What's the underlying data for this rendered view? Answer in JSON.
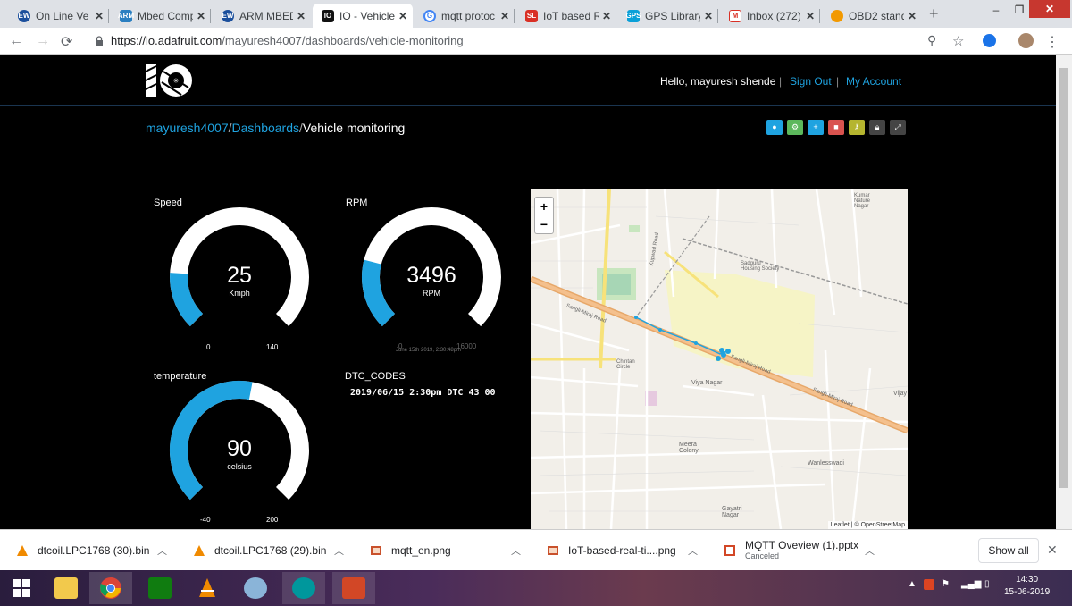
{
  "browser": {
    "tabs": [
      {
        "label": "On Line Ve",
        "fav_color": "#1b4f9c",
        "fav_text": "EW"
      },
      {
        "label": "Mbed Comp",
        "fav_color": "#2a7fc1",
        "fav_text": "ARM"
      },
      {
        "label": "ARM MBED",
        "fav_color": "#1b4f9c",
        "fav_text": "EW"
      },
      {
        "label": "IO - Vehicle",
        "fav_color": "#111111",
        "fav_text": "IO"
      },
      {
        "label": "mqtt protoc",
        "fav_color": "#4285f4",
        "fav_text": "G"
      },
      {
        "label": "IoT based R",
        "fav_color": "#d93025",
        "fav_text": "SL"
      },
      {
        "label": "GPS Library",
        "fav_color": "#0aa0d8",
        "fav_text": "GPS"
      },
      {
        "label": "Inbox (272)",
        "fav_color": "#d93025",
        "fav_text": "M"
      },
      {
        "label": "OBD2 stand",
        "fav_color": "#f29900",
        "fav_text": ""
      }
    ],
    "url_host": "https://io.adafruit.com",
    "url_path": "/mayuresh4007/dashboards/vehicle-monitoring"
  },
  "header": {
    "hello": "Hello, mayuresh shende",
    "sign_out": "Sign Out",
    "my_account": "My Account",
    "sep": "|"
  },
  "breadcrumb": {
    "user": "mayuresh4007",
    "dashboards": "Dashboards",
    "current": "Vehicle monitoring",
    "slash": "/"
  },
  "gauges": {
    "speed": {
      "title": "Speed",
      "value": "25",
      "unit": "Kmph",
      "min": "0",
      "max": "140",
      "fraction": 0.18
    },
    "rpm": {
      "title": "RPM",
      "value": "3496",
      "unit": "RPM",
      "min": "0",
      "max": "16000",
      "fraction": 0.22,
      "timestamp": "June 15th 2019, 2:30:48pm"
    },
    "temperature": {
      "title": "temperature",
      "value": "90",
      "unit": "celsius",
      "min": "-40",
      "max": "200",
      "fraction": 0.54
    }
  },
  "dtc": {
    "title": "DTC_CODES",
    "value": "2019/06/15 2:30pm DTC 43 00"
  },
  "map": {
    "zoom_in": "+",
    "zoom_out": "−",
    "attribution": "Leaflet | © OpenStreetMap",
    "labels": {
      "sangli1": "Sangli-Miraj Road",
      "sangli2": "Sangli-Miraj Road",
      "sangli3": "Sangli-Miraj Road",
      "kupwad": "Kupwad Road",
      "chintan": "Chintan Circle",
      "viya": "Viya Nagar",
      "meera": "Meera Colony",
      "wanle": "Wanlesswadi",
      "gayatri": "Gayatri Nagar",
      "vijay": "Vijay",
      "kumar": "Kumar Nature Nagar",
      "sadguru": "Sadguru Housing Society"
    }
  },
  "downloads": [
    {
      "name": "dtcoil.LPC1768 (30).bin",
      "sub": ""
    },
    {
      "name": "dtcoil.LPC1768 (29).bin",
      "sub": ""
    },
    {
      "name": "mqtt_en.png",
      "sub": ""
    },
    {
      "name": "IoT-based-real-ti....png",
      "sub": ""
    },
    {
      "name": "MQTT Oveview (1).pptx",
      "sub": "Canceled"
    }
  ],
  "show_all": "Show all",
  "clock": {
    "time": "14:30",
    "date": "15-06-2019"
  },
  "colors": {
    "accent": "#1fa3e0",
    "gauge_track": "#ffffff",
    "gauge_fill": "#1fa3e0"
  }
}
